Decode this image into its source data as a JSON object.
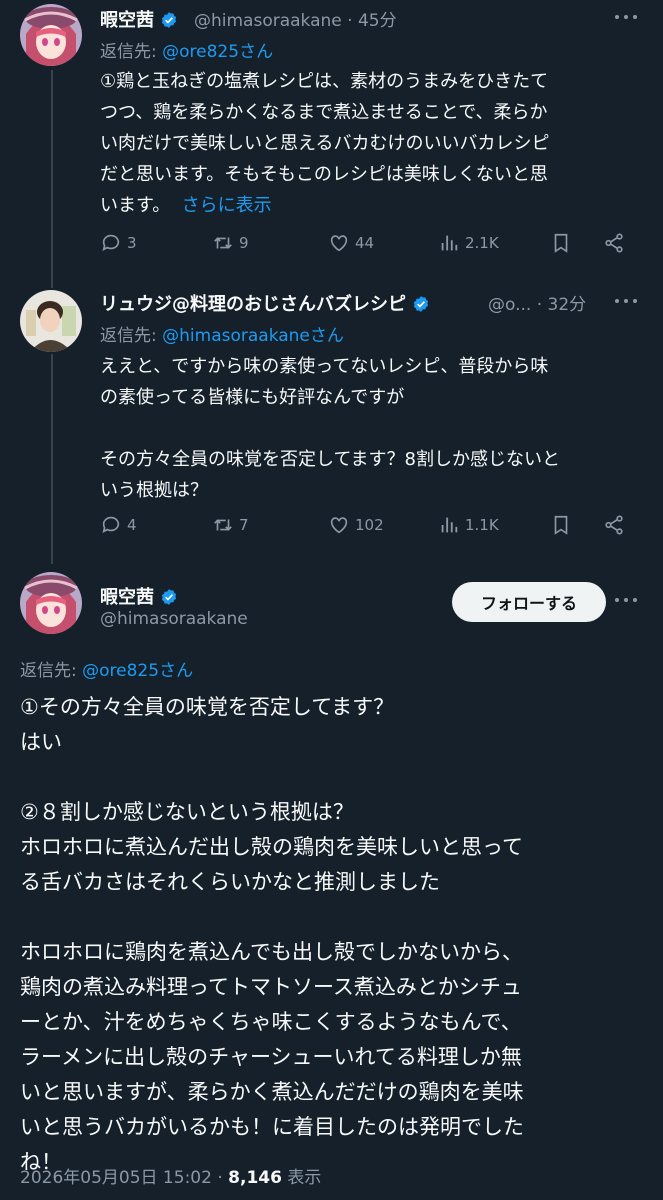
{
  "tweet1": {
    "display_name": "暇空茜",
    "handle": "@himasoraakane",
    "time": "· 45分",
    "reply_to_label": "返信先:",
    "reply_to_handle": "@ore825さん",
    "lines": [
      "①鶏と玉ねぎの塩煮レシピは、素材のうまみをひきたて",
      "つつ、鶏を柔らかくなるまで煮込ませることで、柔らか",
      "い肉だけで美味しいと思えるバカむけのいいバカレシピ",
      "だと思います。そもそもこのレシピは美味しくないと思"
    ],
    "last_line": "います。",
    "show_more": "さらに表示",
    "replies": "3",
    "retweets": "9",
    "likes": "44",
    "views": "2.1K"
  },
  "tweet2": {
    "display_name": "リュウジ@料理のおじさんバズレシピ",
    "handle": "@o...",
    "time": "· 32分",
    "reply_to_label": "返信先:",
    "reply_to_handle": "@himasoraakaneさん",
    "lines": [
      "ええと、ですから味の素使ってないレシピ、普段から味",
      "の素使ってる皆様にも好評なんですが",
      "",
      "その方々全員の味覚を否定してます？8割しか感じないと",
      "いう根拠は？"
    ],
    "replies": "4",
    "retweets": "7",
    "likes": "102",
    "views": "1.1K"
  },
  "tweet3": {
    "display_name": "暇空茜",
    "handle": "@himasoraakane",
    "follow_label": "フォローする",
    "reply_to_label": "返信先:",
    "reply_to_handle": "@ore825さん",
    "lines": [
      "①その方々全員の味覚を否定してます？",
      "はい",
      "",
      "②８割しか感じないという根拠は？",
      "ホロホロに煮込んだ出し殻の鶏肉を美味しいと思って",
      "る舌バカさはそれくらいかなと推測しました",
      "",
      "ホロホロに鶏肉を煮込んでも出し殻でしかないから、",
      "鶏肉の煮込み料理ってトマトソース煮込みとかシチュ",
      "ーとか、汁をめちゃくちゃ味こくするようなもんで、",
      "ラーメンに出し殻のチャーシューいれてる料理しか無",
      "いと思いますが、柔らかく煮込んだだけの鶏肉を美味",
      "いと思うバカがいるかも！に着目したのは発明でした",
      "ね！"
    ],
    "timestamp": "2026年05月05日 15:02",
    "dot": "·",
    "view_count": "8,146",
    "view_label": "表示"
  },
  "icons": {
    "reply": "reply-icon",
    "retweet": "retweet-icon",
    "like": "like-icon",
    "views": "views-icon",
    "bookmark": "bookmark-icon",
    "share": "share-icon",
    "more": "more-icon",
    "verified": "verified-badge-icon"
  },
  "colors": {
    "background": "#15202b",
    "accent": "#1d9bf0",
    "muted": "#8b98a5",
    "text": "#f7f9f9"
  }
}
